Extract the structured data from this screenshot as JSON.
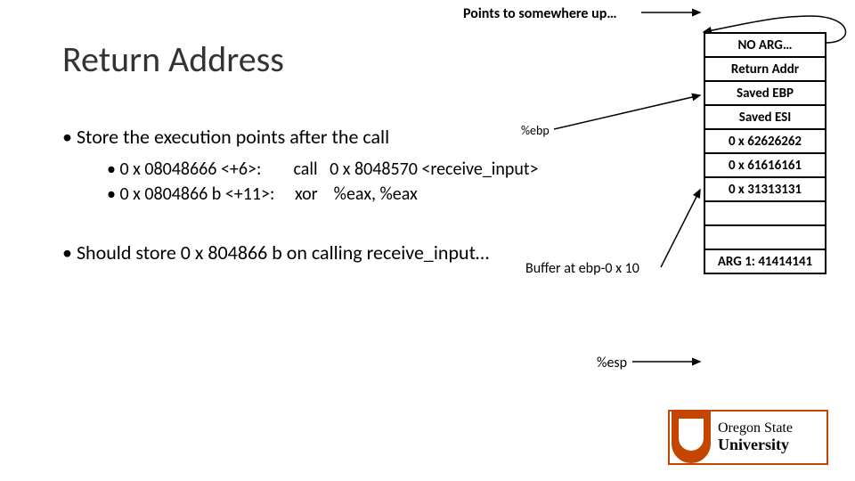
{
  "top_note": "Points to somewhere up…",
  "title": "Return Address",
  "bullet1": "Store the execution points after the call",
  "sub1": "0 x 08048666 <+6>:        call   0 x 8048570 <receive_input>",
  "sub2": "0 x 0804866 b <+11>:     xor    %eax, %eax",
  "bullet2": "Should store 0 x 804866 b on calling receive_input…",
  "buffer_note": "Buffer at ebp-0 x 10",
  "ebp_label": "%ebp",
  "esp_label": "%esp",
  "stack": {
    "c0": "NO ARG…",
    "c1": "Return Addr",
    "c2": "Saved EBP",
    "c3": "Saved ESI",
    "c4": "0 x 62626262",
    "c5": "0 x 61616161",
    "c6": "0 x 31313131",
    "c7": "",
    "c8": "",
    "c9": "ARG 1: 41414141"
  },
  "logo": {
    "line1": "Oregon State",
    "line2": "University"
  }
}
